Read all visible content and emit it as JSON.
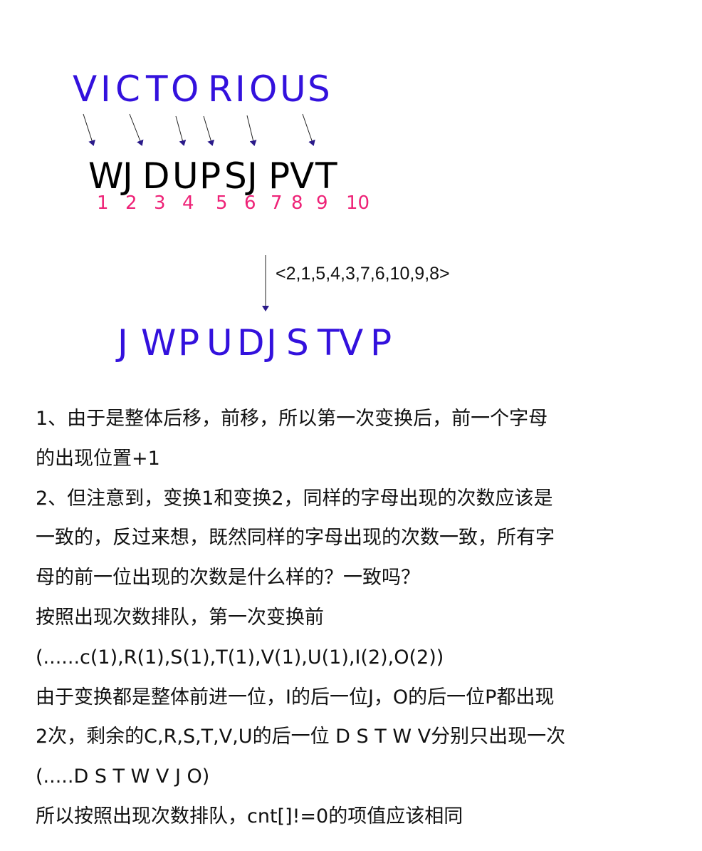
{
  "colors": {
    "blue": "#3311dd",
    "pink": "#ee2277",
    "text": "#111111"
  },
  "diagram": {
    "source_word": [
      "V",
      "I",
      "C",
      "T",
      "O",
      "R",
      "I",
      "O",
      "U",
      "S"
    ],
    "encrypted_word": [
      "W",
      "J",
      "D",
      "U",
      "P",
      "S",
      "J",
      "P",
      "V",
      "T"
    ],
    "positions": [
      "1",
      "2",
      "3",
      "4",
      "5",
      "6",
      "7",
      "8",
      "9",
      "10"
    ],
    "permutation_label": "<2,1,5,4,3,7,6,10,9,8>",
    "result_word": [
      "J",
      "W",
      "P",
      "U",
      "D",
      "J",
      "S",
      "T",
      "V",
      "P"
    ]
  },
  "notes": [
    "1、由于是整体后移，前移，所以第一次变换后，前一个字母",
    "的出现位置+1",
    "2、但注意到，变换1和变换2，同样的字母出现的次数应该是",
    "一致的，反过来想，既然同样的字母出现的次数一致，所有字",
    "母的前一位出现的次数是什么样的？一致吗？",
    "按照出现次数排队，第一次变换前",
    "(......c(1),R(1),S(1),T(1),V(1),U(1),I(2),O(2))",
    "由于变换都是整体前进一位，I的后一位J，O的后一位P都出现",
    "2次，剩余的C,R,S,T,V,U的后一位 D S T W V分别只出现一次",
    "(.....D S T W V    J O)",
    "所以按照出现次数排队，cnt[]!=0的项值应该相同"
  ]
}
